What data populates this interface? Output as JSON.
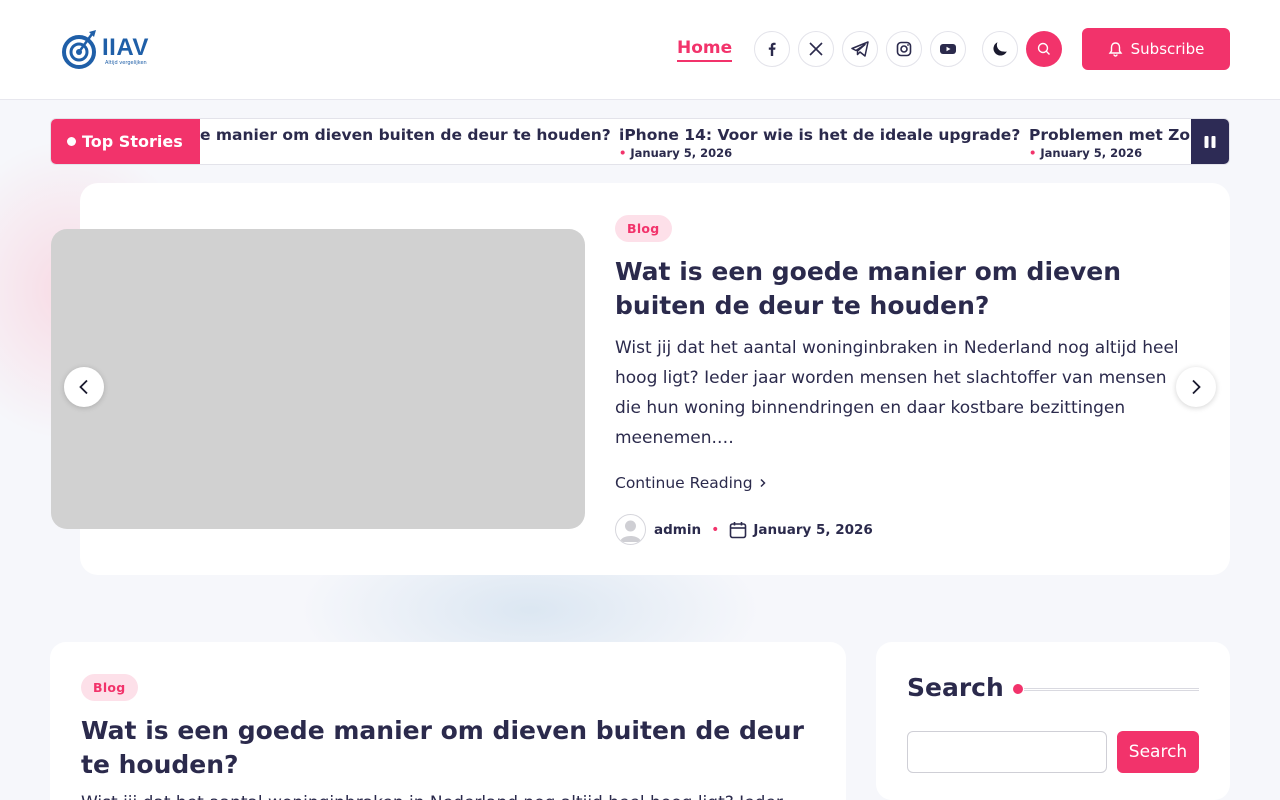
{
  "colors": {
    "accent": "#f2336b",
    "text": "#2b2a4c",
    "background": "#f6f7fb",
    "image_placeholder": "#d1d1d1",
    "logo": "#1f5fa8"
  },
  "header": {
    "logo_text": "IIAV",
    "logo_tagline": "Altijd vergelijken",
    "nav": [
      {
        "label": "Home",
        "active": true
      }
    ],
    "social_icons": [
      "facebook-icon",
      "x-twitter-icon",
      "telegram-icon",
      "instagram-icon",
      "youtube-icon"
    ],
    "subscribe_label": "Subscribe"
  },
  "ticker": {
    "label": "Top Stories",
    "items": [
      {
        "title": "Wat is een goede manier om dieven buiten de deur te houden?",
        "visible_title": "e manier om dieven buiten de deur te houden?",
        "date": ""
      },
      {
        "title": "iPhone 14: Voor wie is het de ideale upgrade?",
        "date": "January 5, 2026"
      },
      {
        "title": "Problemen met Zon",
        "date": "January 5, 2026"
      }
    ]
  },
  "slider": {
    "category": "Blog",
    "title": "Wat is een goede manier om dieven buiten de deur te houden?",
    "excerpt": "Wist jij dat het aantal woninginbraken in Nederland nog altijd heel hoog ligt? Ieder jaar worden mensen het slachtoffer van mensen die hun woning binnendringen en daar kostbare bezittingen meenemen.…",
    "continue_label": "Continue Reading",
    "author": "admin",
    "date": "January 5, 2026"
  },
  "post": {
    "category": "Blog",
    "title": "Wat is een goede manier om dieven buiten de deur te houden?",
    "excerpt": "Wist jij dat het aantal woninginbraken in Nederland nog altijd heel hoog ligt? Ieder"
  },
  "sidebar": {
    "search_title": "Search",
    "search_placeholder": "",
    "search_button": "Search"
  }
}
